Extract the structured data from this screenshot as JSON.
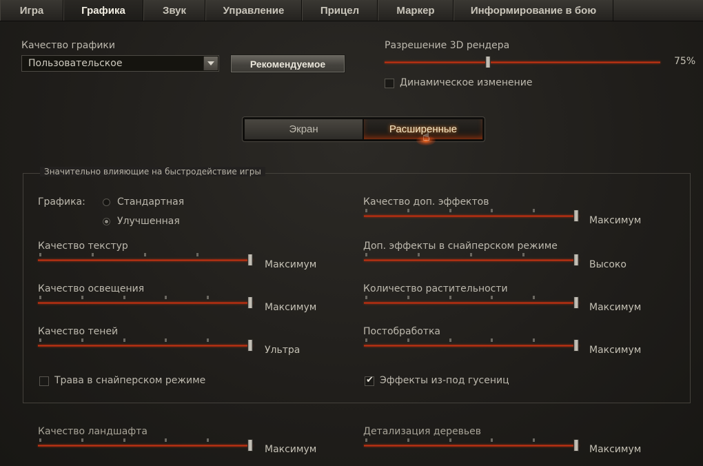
{
  "tabs": [
    {
      "label": "Игра"
    },
    {
      "label": "Графика"
    },
    {
      "label": "Звук"
    },
    {
      "label": "Управление"
    },
    {
      "label": "Прицел"
    },
    {
      "label": "Маркер"
    },
    {
      "label": "Информирование в бою"
    }
  ],
  "quality": {
    "label": "Качество графики",
    "selected": "Пользовательское",
    "recommended_button": "Рекомендуемое"
  },
  "render": {
    "label": "Разрешение 3D рендера",
    "value_text": "75%",
    "value": 0.75,
    "dynamic_label": "Динамическое изменение",
    "dynamic_checked": false
  },
  "subtabs": [
    {
      "label": "Экран"
    },
    {
      "label": "Расширенные"
    }
  ],
  "group": {
    "title": "Значительно влияющие на быстродействие игры",
    "graphics_label": "Графика:",
    "graphics_options": [
      {
        "label": "Стандартная",
        "selected": false
      },
      {
        "label": "Улучшенная",
        "selected": true
      }
    ],
    "left_sliders": [
      {
        "label": "Качество текстур",
        "value_label": "Максимум",
        "level": 1.0,
        "ticks": 4
      },
      {
        "label": "Качество освещения",
        "value_label": "Максимум",
        "level": 1.0,
        "ticks": 5
      },
      {
        "label": "Качество теней",
        "value_label": "Ультра",
        "level": 1.0,
        "ticks": 5
      }
    ],
    "right_sliders": [
      {
        "label": "Качество доп. эффектов",
        "value_label": "Максимум",
        "level": 1.0,
        "ticks": 5
      },
      {
        "label": "Доп. эффекты в снайперском режиме",
        "value_label": "Высоко",
        "level": 1.0,
        "ticks": 4
      },
      {
        "label": "Количество растительности",
        "value_label": "Максимум",
        "level": 1.0,
        "ticks": 5
      },
      {
        "label": "Постобработка",
        "value_label": "Максимум",
        "level": 1.0,
        "ticks": 5
      }
    ],
    "grass_label": "Трава в снайперском режиме",
    "grass_checked": false,
    "track_effects_label": "Эффекты из-под гусениц",
    "track_effects_checked": true
  },
  "bottom": {
    "left": {
      "label": "Качество ландшафта",
      "value_label": "Максимум",
      "level": 1.0,
      "ticks": 5
    },
    "right": {
      "label": "Детализация деревьев",
      "value_label": "Максимум",
      "level": 1.0,
      "ticks": 5
    }
  },
  "colors": {
    "slider_track": "#c63d18",
    "active_subtab_glow": "#ff8a30"
  }
}
